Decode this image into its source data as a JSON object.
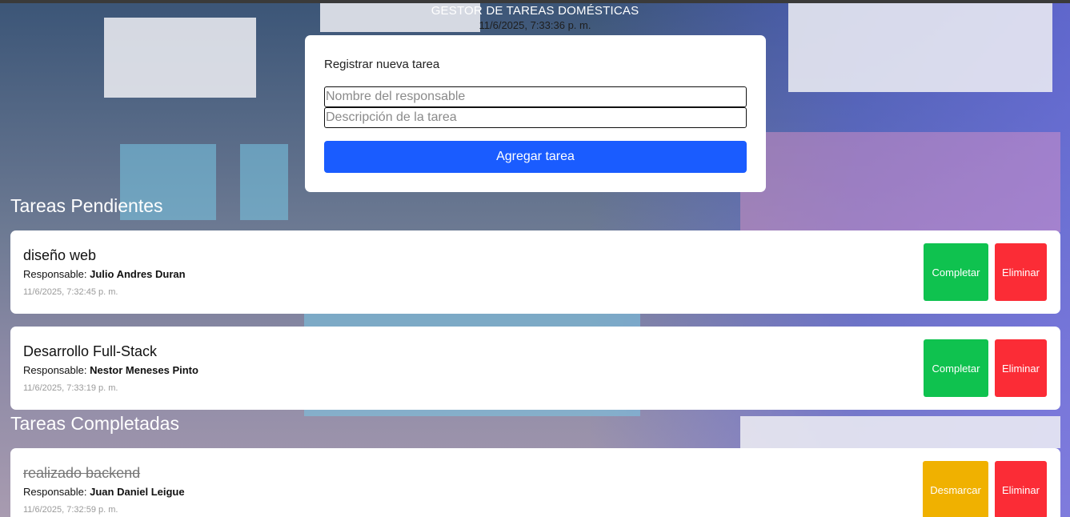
{
  "header": {
    "title": "GESTOR DE TAREAS DOMÉSTICAS",
    "clock": "11/6/2025, 7:33:36 p. m."
  },
  "form": {
    "title": "Registrar nueva tarea",
    "responsible_placeholder": "Nombre del responsable",
    "responsible_value": "",
    "description_placeholder": "Descripción de la tarea",
    "description_value": "",
    "submit_label": "Agregar tarea"
  },
  "pending": {
    "title": "Tareas Pendientes",
    "tasks": [
      {
        "name": "diseño web",
        "responsible_label": "Responsable:",
        "responsible": "Julio Andres Duran",
        "date": "11/6/2025, 7:32:45 p. m.",
        "complete_label": "Completar",
        "delete_label": "Eliminar"
      },
      {
        "name": "Desarrollo Full-Stack",
        "responsible_label": "Responsable:",
        "responsible": "Nestor Meneses Pinto",
        "date": "11/6/2025, 7:33:19 p. m.",
        "complete_label": "Completar",
        "delete_label": "Eliminar"
      }
    ]
  },
  "completed": {
    "title": "Tareas Completadas",
    "tasks": [
      {
        "name": "realizado backend",
        "responsible_label": "Responsable:",
        "responsible": "Juan Daniel Leigue",
        "date": "11/6/2025, 7:32:59 p. m.",
        "unmark_label": "Desmarcar",
        "delete_label": "Eliminar"
      }
    ]
  },
  "colors": {
    "primary": "#1a5cff",
    "complete": "#0fc24f",
    "unmark": "#f0b100",
    "delete": "#fb2c36"
  }
}
